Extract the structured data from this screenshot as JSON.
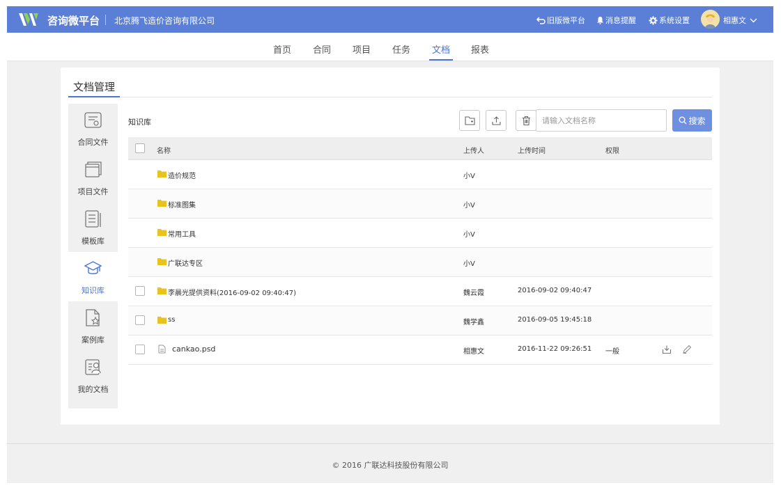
{
  "header": {
    "brand": "咨询微平台",
    "company": "北京腾飞造价咨询有限公司",
    "actions": {
      "old_version": "旧版微平台",
      "notifications": "消息提醒",
      "settings": "系统设置",
      "user_name": "相惠文"
    }
  },
  "nav": {
    "items": [
      {
        "label": "首页"
      },
      {
        "label": "合同"
      },
      {
        "label": "项目"
      },
      {
        "label": "任务"
      },
      {
        "label": "文档"
      },
      {
        "label": "报表"
      }
    ],
    "active": "文档"
  },
  "card": {
    "title": "文档管理"
  },
  "sidebar": {
    "items": [
      {
        "label": "合同文件",
        "icon": "contract-file-icon"
      },
      {
        "label": "项目文件",
        "icon": "project-file-icon"
      },
      {
        "label": "模板库",
        "icon": "template-icon"
      },
      {
        "label": "知识库",
        "icon": "graduation-cap-icon"
      },
      {
        "label": "案例库",
        "icon": "case-star-icon"
      },
      {
        "label": "我的文档",
        "icon": "my-docs-icon"
      }
    ],
    "active": "知识库"
  },
  "content": {
    "breadcrumb": "知识库",
    "search_placeholder": "请输入文档名称",
    "search_button": "搜索"
  },
  "table": {
    "headers": {
      "name": "名称",
      "uploader": "上传人",
      "upload_time": "上传时间",
      "permission": "权限"
    },
    "rows": [
      {
        "name": "造价规范",
        "uploader": "小V",
        "time": "",
        "permission": "",
        "type": "folder",
        "checkbox": false
      },
      {
        "name": "标准图集",
        "uploader": "小V",
        "time": "",
        "permission": "",
        "type": "folder",
        "checkbox": false
      },
      {
        "name": "常用工具",
        "uploader": "小V",
        "time": "",
        "permission": "",
        "type": "folder",
        "checkbox": false
      },
      {
        "name": "广联达专区",
        "uploader": "小V",
        "time": "",
        "permission": "",
        "type": "folder",
        "checkbox": false
      },
      {
        "name": "李晨光提供资料(2016-09-02 09:40:47)",
        "uploader": "魏云霞",
        "time": "2016-09-02 09:40:47",
        "permission": "",
        "type": "folder",
        "checkbox": true
      },
      {
        "name": "ss",
        "uploader": "魏学鑫",
        "time": "2016-09-05 19:45:18",
        "permission": "",
        "type": "folder",
        "checkbox": true
      },
      {
        "name": "cankao.psd",
        "uploader": "相惠文",
        "time": "2016-11-22 09:26:51",
        "permission": "一般",
        "type": "file",
        "checkbox": true
      }
    ]
  },
  "footer": {
    "copyright": "© 2016 广联达科技股份有限公司"
  },
  "colors": {
    "header_bg": "#5b7fd6",
    "accent": "#4a74d8",
    "search_button": "#6f90e0",
    "folder": "#e8c21e"
  }
}
